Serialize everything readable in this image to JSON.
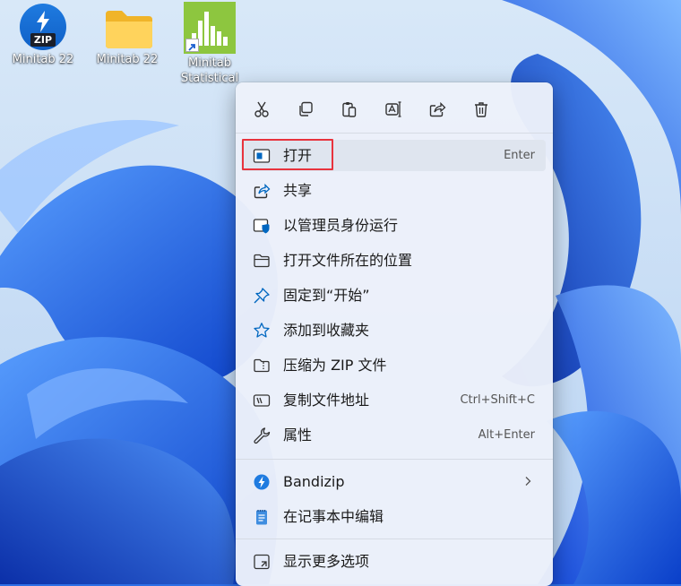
{
  "desktop": {
    "icons": [
      {
        "label": "Minitab 22",
        "icon": "bandizip-zip-icon",
        "badge": "ZIP"
      },
      {
        "label": "Minitab 22",
        "icon": "folder-icon"
      },
      {
        "label_line1": "Minitab",
        "label_line2": "Statistical",
        "icon": "minitab-app-icon"
      }
    ]
  },
  "toolbar": {
    "buttons": [
      {
        "name": "cut",
        "icon": "scissors-icon"
      },
      {
        "name": "copy",
        "icon": "copy-icon"
      },
      {
        "name": "paste",
        "icon": "paste-icon"
      },
      {
        "name": "rename",
        "icon": "rename-icon"
      },
      {
        "name": "share",
        "icon": "share-icon"
      },
      {
        "name": "delete",
        "icon": "trash-icon"
      }
    ]
  },
  "menu": {
    "items": [
      {
        "label": "打开",
        "shortcut": "Enter",
        "icon": "open-window-icon"
      },
      {
        "label": "共享",
        "icon": "share-icon"
      },
      {
        "label": "以管理员身份运行",
        "icon": "admin-shield-icon"
      },
      {
        "label": "打开文件所在的位置",
        "icon": "folder-outline-icon"
      },
      {
        "label": "固定到“开始”",
        "icon": "pin-icon"
      },
      {
        "label": "添加到收藏夹",
        "icon": "star-icon"
      },
      {
        "label": "压缩为 ZIP 文件",
        "icon": "zip-folder-icon"
      },
      {
        "label": "复制文件地址",
        "shortcut": "Ctrl+Shift+C",
        "icon": "copy-path-icon"
      },
      {
        "label": "属性",
        "shortcut": "Alt+Enter",
        "icon": "wrench-icon"
      },
      {
        "label": "Bandizip",
        "icon": "bandizip-icon"
      },
      {
        "label": "在记事本中编辑",
        "icon": "notepad-icon"
      },
      {
        "label": "显示更多选项",
        "icon": "more-options-icon"
      }
    ]
  },
  "colors": {
    "wallpaper_blue": "#2f6fe6",
    "menu_bg": "#ecf1fa",
    "accent": "#0067c0",
    "highlight_border": "#e8333d",
    "minitab_green": "#8dc63f"
  }
}
